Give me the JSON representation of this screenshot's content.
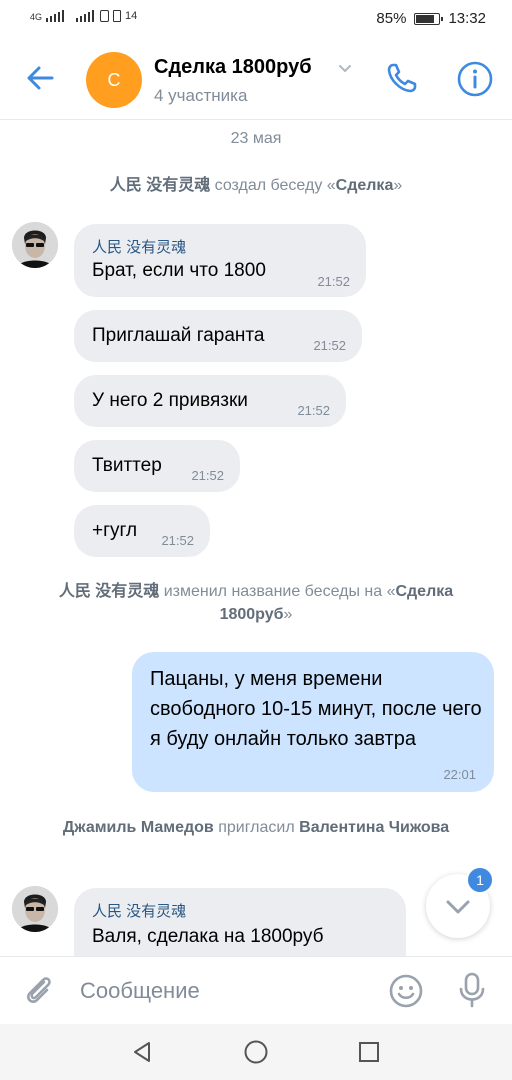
{
  "status_bar": {
    "network": "4G",
    "signal_extra": "14",
    "battery": "85%",
    "battery_level": 0.85,
    "time": "13:32"
  },
  "header": {
    "avatar_letter": "С",
    "title": "Сделка 1800руб",
    "subtitle": "4 участника"
  },
  "colors": {
    "accent": "#3f8ae0",
    "avatar": "#ff9e1f",
    "incoming_bubble": "#ebedf0",
    "outgoing_bubble": "#cce4ff",
    "author": "#2a5885"
  },
  "messages": {
    "date": "23 мая",
    "service1": {
      "actor": "人民 没有灵魂",
      "action": " создал беседу «",
      "target": "Сделка",
      "end": "»"
    },
    "m1": {
      "author": "人民 没有灵魂",
      "text": "Брат, если что 1800",
      "time": "21:52"
    },
    "m2": {
      "text": "Приглашай гаранта",
      "time": "21:52"
    },
    "m3": {
      "text": "У него 2 привязки",
      "time": "21:52"
    },
    "m4": {
      "text": "Твиттер",
      "time": "21:52"
    },
    "m5": {
      "text": "+гугл",
      "time": "21:52"
    },
    "service2": {
      "actor": "人民 没有灵魂",
      "action": " изменил название беседы на «",
      "target": "Сделка 1800руб",
      "end": "»"
    },
    "out1": {
      "text": "Пацаны, у меня времени свободного 10-15 минут, после чего я буду онлайн только завтра",
      "time": "22:01"
    },
    "service3": {
      "actor": "Джамиль Мамедов",
      "action": " пригласил ",
      "target": "Валентина Чижова"
    },
    "m6": {
      "author": "人民 没有灵魂",
      "text": "Валя, сделака на 1800руб"
    }
  },
  "scroll_badge": "1",
  "composer": {
    "placeholder": "Сообщение"
  },
  "icons": [
    "back-arrow-icon",
    "chevron-down-icon",
    "phone-icon",
    "info-icon",
    "chevron-down-icon",
    "paperclip-icon",
    "smile-icon",
    "microphone-icon",
    "nav-back-icon",
    "nav-home-icon",
    "nav-recent-icon"
  ]
}
